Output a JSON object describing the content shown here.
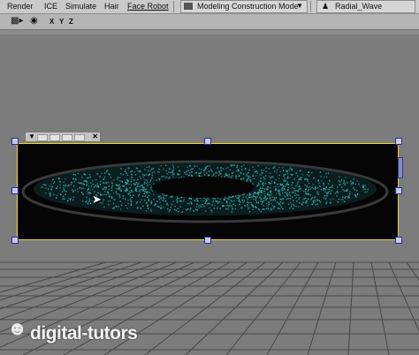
{
  "menu": {
    "items": [
      "Render",
      "ICE",
      "Simulate",
      "Hair",
      "Face Robot"
    ],
    "mode_select": "Modeling Construction Mode",
    "mode_arrow": "▼",
    "object_name": "Radial_Wave"
  },
  "toolbar": {
    "camera_icon": "camera-icon",
    "eye_icon": "eye-icon",
    "axes": [
      "X",
      "Y",
      "Z"
    ]
  },
  "viewer": {
    "particle_color": "#3fb9b8",
    "frame_color": "#e6da2a",
    "handle_color": "#2a2a9a"
  },
  "logo": {
    "text": "digital-tutors"
  }
}
